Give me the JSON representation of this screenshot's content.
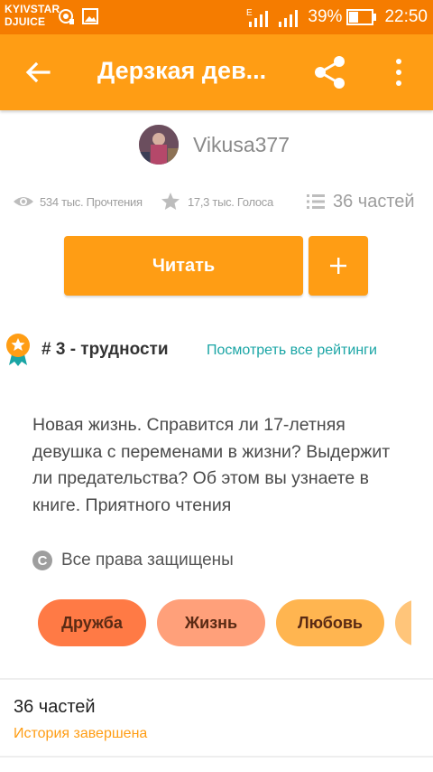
{
  "status_bar": {
    "carrier_line1": "KYIVSTAR",
    "carrier_line2": "DJUICE",
    "battery": "39%",
    "time": "22:50",
    "network": "E"
  },
  "app_bar": {
    "title": "Дерзкая дев...",
    "back_icon": "arrow-left-icon",
    "share_icon": "share-icon",
    "more_icon": "more-vertical-icon"
  },
  "author": {
    "name": "Vikusa377"
  },
  "stats": {
    "reads": "534 тыс. Прочтения",
    "votes": "17,3 тыс. Голоса",
    "parts": "36 частей"
  },
  "actions": {
    "read_label": "Читать",
    "add_label": "+"
  },
  "ranking": {
    "text": "# 3 - трудности",
    "link": "Посмотреть все рейтинги"
  },
  "description": "Новая жизнь. Справится ли 17-летняя девушка с переменами в жизни? Выдержит ли предательства? Об этом вы узнаете в книге. Приятного чтения",
  "copyright": {
    "icon_letter": "C",
    "text": "Все права защищены"
  },
  "tags": [
    "Дружба",
    "Жизнь",
    "Любовь",
    ""
  ],
  "parts_section": {
    "title": "36 частей",
    "status": "История завершена"
  },
  "colors": {
    "status_bar": "#f57c00",
    "app_bar": "#ff9d14",
    "accent": "#ff9d14",
    "link": "#1aa5a5"
  }
}
